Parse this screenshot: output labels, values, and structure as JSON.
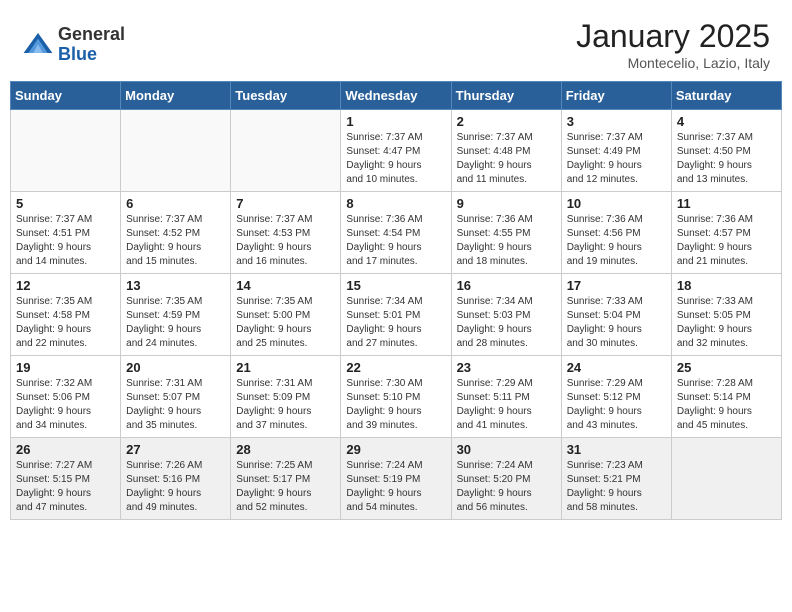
{
  "header": {
    "logo_general": "General",
    "logo_blue": "Blue",
    "month": "January 2025",
    "location": "Montecelio, Lazio, Italy"
  },
  "days_of_week": [
    "Sunday",
    "Monday",
    "Tuesday",
    "Wednesday",
    "Thursday",
    "Friday",
    "Saturday"
  ],
  "weeks": [
    [
      {
        "day": "",
        "info": ""
      },
      {
        "day": "",
        "info": ""
      },
      {
        "day": "",
        "info": ""
      },
      {
        "day": "1",
        "info": "Sunrise: 7:37 AM\nSunset: 4:47 PM\nDaylight: 9 hours\nand 10 minutes."
      },
      {
        "day": "2",
        "info": "Sunrise: 7:37 AM\nSunset: 4:48 PM\nDaylight: 9 hours\nand 11 minutes."
      },
      {
        "day": "3",
        "info": "Sunrise: 7:37 AM\nSunset: 4:49 PM\nDaylight: 9 hours\nand 12 minutes."
      },
      {
        "day": "4",
        "info": "Sunrise: 7:37 AM\nSunset: 4:50 PM\nDaylight: 9 hours\nand 13 minutes."
      }
    ],
    [
      {
        "day": "5",
        "info": "Sunrise: 7:37 AM\nSunset: 4:51 PM\nDaylight: 9 hours\nand 14 minutes."
      },
      {
        "day": "6",
        "info": "Sunrise: 7:37 AM\nSunset: 4:52 PM\nDaylight: 9 hours\nand 15 minutes."
      },
      {
        "day": "7",
        "info": "Sunrise: 7:37 AM\nSunset: 4:53 PM\nDaylight: 9 hours\nand 16 minutes."
      },
      {
        "day": "8",
        "info": "Sunrise: 7:36 AM\nSunset: 4:54 PM\nDaylight: 9 hours\nand 17 minutes."
      },
      {
        "day": "9",
        "info": "Sunrise: 7:36 AM\nSunset: 4:55 PM\nDaylight: 9 hours\nand 18 minutes."
      },
      {
        "day": "10",
        "info": "Sunrise: 7:36 AM\nSunset: 4:56 PM\nDaylight: 9 hours\nand 19 minutes."
      },
      {
        "day": "11",
        "info": "Sunrise: 7:36 AM\nSunset: 4:57 PM\nDaylight: 9 hours\nand 21 minutes."
      }
    ],
    [
      {
        "day": "12",
        "info": "Sunrise: 7:35 AM\nSunset: 4:58 PM\nDaylight: 9 hours\nand 22 minutes."
      },
      {
        "day": "13",
        "info": "Sunrise: 7:35 AM\nSunset: 4:59 PM\nDaylight: 9 hours\nand 24 minutes."
      },
      {
        "day": "14",
        "info": "Sunrise: 7:35 AM\nSunset: 5:00 PM\nDaylight: 9 hours\nand 25 minutes."
      },
      {
        "day": "15",
        "info": "Sunrise: 7:34 AM\nSunset: 5:01 PM\nDaylight: 9 hours\nand 27 minutes."
      },
      {
        "day": "16",
        "info": "Sunrise: 7:34 AM\nSunset: 5:03 PM\nDaylight: 9 hours\nand 28 minutes."
      },
      {
        "day": "17",
        "info": "Sunrise: 7:33 AM\nSunset: 5:04 PM\nDaylight: 9 hours\nand 30 minutes."
      },
      {
        "day": "18",
        "info": "Sunrise: 7:33 AM\nSunset: 5:05 PM\nDaylight: 9 hours\nand 32 minutes."
      }
    ],
    [
      {
        "day": "19",
        "info": "Sunrise: 7:32 AM\nSunset: 5:06 PM\nDaylight: 9 hours\nand 34 minutes."
      },
      {
        "day": "20",
        "info": "Sunrise: 7:31 AM\nSunset: 5:07 PM\nDaylight: 9 hours\nand 35 minutes."
      },
      {
        "day": "21",
        "info": "Sunrise: 7:31 AM\nSunset: 5:09 PM\nDaylight: 9 hours\nand 37 minutes."
      },
      {
        "day": "22",
        "info": "Sunrise: 7:30 AM\nSunset: 5:10 PM\nDaylight: 9 hours\nand 39 minutes."
      },
      {
        "day": "23",
        "info": "Sunrise: 7:29 AM\nSunset: 5:11 PM\nDaylight: 9 hours\nand 41 minutes."
      },
      {
        "day": "24",
        "info": "Sunrise: 7:29 AM\nSunset: 5:12 PM\nDaylight: 9 hours\nand 43 minutes."
      },
      {
        "day": "25",
        "info": "Sunrise: 7:28 AM\nSunset: 5:14 PM\nDaylight: 9 hours\nand 45 minutes."
      }
    ],
    [
      {
        "day": "26",
        "info": "Sunrise: 7:27 AM\nSunset: 5:15 PM\nDaylight: 9 hours\nand 47 minutes."
      },
      {
        "day": "27",
        "info": "Sunrise: 7:26 AM\nSunset: 5:16 PM\nDaylight: 9 hours\nand 49 minutes."
      },
      {
        "day": "28",
        "info": "Sunrise: 7:25 AM\nSunset: 5:17 PM\nDaylight: 9 hours\nand 52 minutes."
      },
      {
        "day": "29",
        "info": "Sunrise: 7:24 AM\nSunset: 5:19 PM\nDaylight: 9 hours\nand 54 minutes."
      },
      {
        "day": "30",
        "info": "Sunrise: 7:24 AM\nSunset: 5:20 PM\nDaylight: 9 hours\nand 56 minutes."
      },
      {
        "day": "31",
        "info": "Sunrise: 7:23 AM\nSunset: 5:21 PM\nDaylight: 9 hours\nand 58 minutes."
      },
      {
        "day": "",
        "info": ""
      }
    ]
  ]
}
